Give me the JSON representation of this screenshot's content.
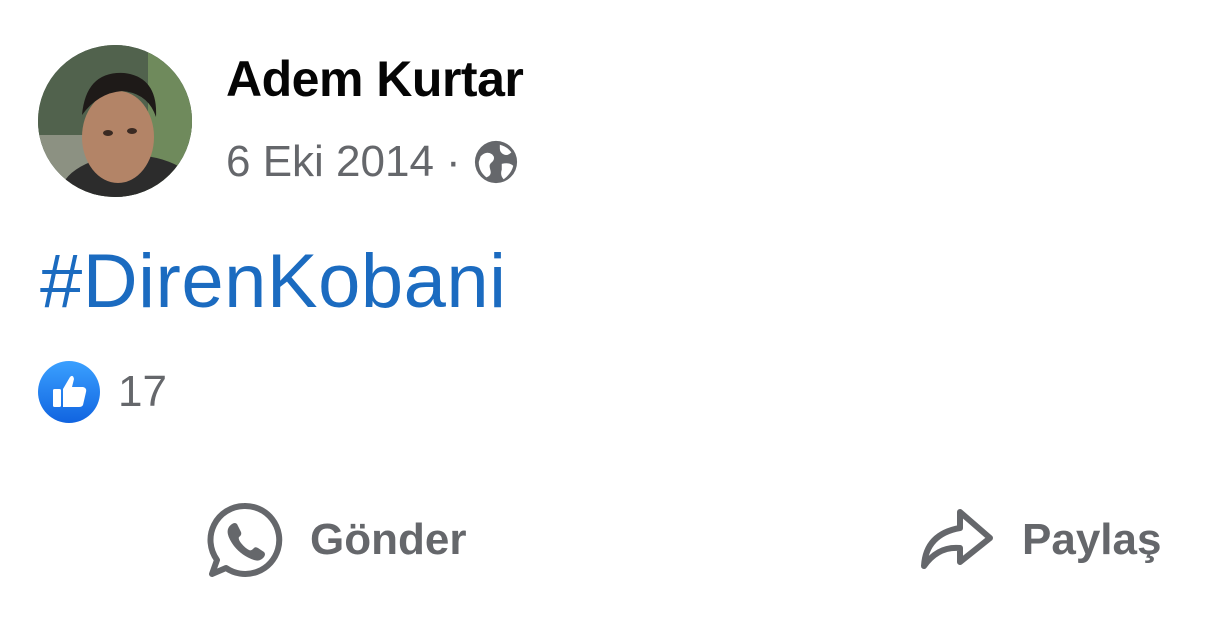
{
  "post": {
    "author": "Adem Kurtar",
    "date": "6 Eki 2014",
    "separator": "·",
    "visibility_icon": "globe-icon",
    "text": "#DirenKobani",
    "reactions": {
      "icon": "like-icon",
      "count": "17"
    },
    "actions": {
      "send_label": "Gönder",
      "send_icon": "whatsapp-icon",
      "share_label": "Paylaş",
      "share_icon": "share-arrow-icon"
    }
  },
  "colors": {
    "hashtag": "#1b6bc0",
    "like_blue": "#1877f2",
    "secondary_text": "#65676b",
    "primary_text": "#050505"
  }
}
